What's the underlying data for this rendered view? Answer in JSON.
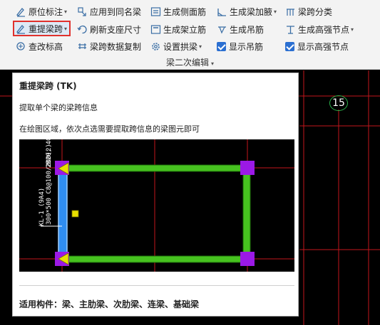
{
  "ribbon": {
    "row1": {
      "yuanwei": "原位标注",
      "yingyong": "应用到同名梁",
      "cemian": "生成侧面筋",
      "jiaye": "生成梁加腋",
      "fenlei": "梁跨分类"
    },
    "row2": {
      "chongti": "重提梁跨",
      "shuaxin": "刷新支座尺寸",
      "jiali": "生成架立筋",
      "diao": "生成吊筋",
      "gaoqiang": "生成高强节点"
    },
    "row3": {
      "chagai": "查改标高",
      "fuzhi": "梁跨数据复制",
      "gongqi": "设置拱梁",
      "show_diao": "显示吊筋",
      "show_gaoqiang": "显示高强节点"
    },
    "group": "梁二次编辑"
  },
  "canvas": {
    "axis_number": "15"
  },
  "tooltip": {
    "title": "重提梁跨 (TK)",
    "description": "提取单个梁的梁跨信息",
    "hint": "在绘图区域，依次点选需要提取跨信息的梁图元即可",
    "image_labels": {
      "dim_top": "300*500 C8@100/200(2)",
      "dim_side": "2B20; 4C",
      "beam_name": "KL-1 (9A4)"
    },
    "footer": "适用构件：梁、主肋梁、次肋梁、连梁、基础梁"
  },
  "colors": {
    "accent_red": "#e0312d",
    "checkbox_blue": "#2b6fd1",
    "beam_green": "#46c21f",
    "column_purple": "#9b19e6",
    "grid_red": "#c4161c",
    "selected_blue": "#2f8df0",
    "marker_yellow": "#e8e000"
  }
}
